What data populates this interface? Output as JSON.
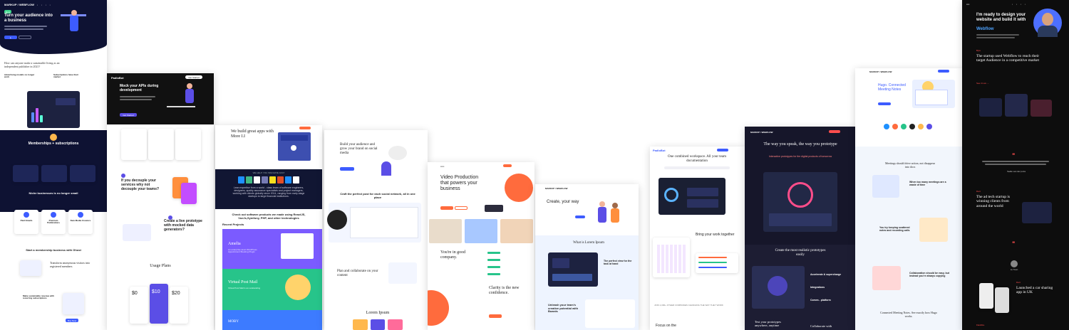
{
  "colors": {
    "navy": "#0e1233",
    "purple": "#5b4ee6",
    "blue": "#3d5cff",
    "orange": "#ff6b3d",
    "dark": "#16162a",
    "black": "#0d0d0d",
    "accent_red": "#ff4d4d"
  },
  "panel1": {
    "logo": "MARKUP / WEBFLOW",
    "badge": "New",
    "headline": "Turn your audience into a business",
    "section_title": "How can anyone make a sustainable living as an independent publisher in 2021?",
    "col1_title": "Advertising models no longer work",
    "col2_title": "Subscriptions have their market",
    "memberships_title": "Memberships + subscriptions",
    "niche_title": "Niche businesses is no longer small",
    "cards": [
      "Paid Emails",
      "Premium Publications",
      "New Media Creators"
    ],
    "start_title": "Start a membership business with Ghost",
    "transform_title": "Transform anonymous visitors into registered members",
    "build_title": "Make sustainable revenue with recurring subscriptions",
    "footer_btn": "Buy Now"
  },
  "panel2": {
    "logo": "PadloBot",
    "nav_cta": "Get Started",
    "headline": "Mock your APIs during development",
    "cta": "Get Started",
    "decouple_title": "If you decouple your services why not decouple your teams?",
    "create_title": "Create a live prototype with mocked data generators?",
    "usage_title": "Usage Plans",
    "prices": [
      "$0",
      "$10",
      "$20"
    ]
  },
  "panel3": {
    "headline": "We build great apps with More I.I",
    "band_title": "WE HELP YOU INNOVATE FAST",
    "band_text": "Lean expertise from a world - class team of software engineers, designers, quality assurance specialists and project managers, working with clients globally since 2014, ranging from early-stage startups to large financial institutions.",
    "software_title": "Check out software products we made using ReactJS, VueJs,Symfony, PHP, and other technologies",
    "recent_title": "Recent Projects",
    "projects": [
      "Amelia",
      "Virtual Post Mail",
      "MOBY"
    ],
    "amelia_text": "An enterprise-level WordPress Appointment Booking Plugin",
    "vpm_text": "Virtual Post Mail is an outstanding"
  },
  "panel4": {
    "headline": "Build your audience and grow your brand on social media",
    "craft_title": "Craft the perfect post for each social network, all in one place",
    "plan_title": "Plan and collaborate on your content",
    "lorem_title": "Lorem Ipsum"
  },
  "panel5": {
    "headline": "Video Production that powers your business",
    "good_company": "You're in good company.",
    "clarity": "Clarity is the new confidence."
  },
  "panel6": {
    "logo": "MARKUP / WEBFLOW",
    "headline": "Create, your way",
    "lorem_title": "What is Lorem Ipsum",
    "perfect": "The perfect view for the task at hand",
    "unleash": "Unleash your team's creative potential with Boards"
  },
  "panel7": {
    "logo": "PadloBot",
    "headline": "One combined workspace. All your team documentation",
    "bring_title": "Bring your work together",
    "join_text": "JOIN 1,000+ OTHER COMPANIES CHANGING THE WAY THEY WORK",
    "focus": "Focus on the"
  },
  "panel8": {
    "headline": "The way you speak, the way you prototype",
    "sub": "Interactive prototypes for the digital products of tomorrow",
    "most_realistic": "Create the most realistic prototypes easily",
    "bullets": [
      "Accelerate & supercharge",
      "Integrations",
      "Comes - platform"
    ],
    "test_title": "Test your prototypes anywhere, anytime",
    "collab_title": "Collaborate with"
  },
  "panel9": {
    "logo": "MARKUP / WEBFLOW",
    "headline": "Hugo. Connected Meeting Notes",
    "meetings_title": "Meetings should drive action, not disappear into docs",
    "waste_title": "When too many meetings are a waste of time",
    "keeping_title": "You try keeping scattered notes and recording calls",
    "collab_title": "Collaboration should be easy, but instead you're always copying",
    "footer_title": "Connected Meeting Notes. See exactly how Hugo works."
  },
  "panel10": {
    "headline": "I'm ready to design your website and build it with",
    "highlight": "Webflow",
    "label1": "Byte",
    "startup_title": "The startup used Webflow to reach their target Audience in a competitive market",
    "see_case": "See it Live →",
    "label2": "Dart",
    "adtech_title": "The ad tech startup is winning clients from around the world",
    "author1": "Sadie van der poza",
    "label3": "Dart",
    "car_title": "Launched a car sharing app in UK",
    "author2": "Lu Toen",
    "label4": "Fleckfire"
  }
}
